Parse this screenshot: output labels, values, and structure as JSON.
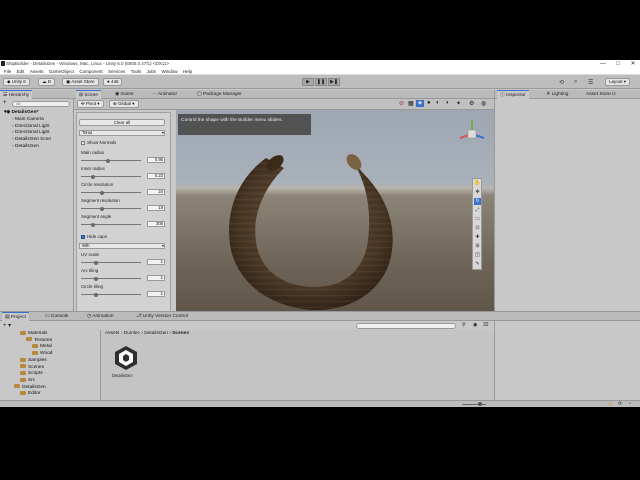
{
  "window": {
    "title": "ShipBuilder - DetailsGen - Windows, Mac, Linux - Unity 6.0 (6000.0.47f1) <DX11>",
    "controls": [
      "—",
      "□",
      "✕"
    ]
  },
  "menu": [
    "File",
    "Edit",
    "Assets",
    "GameObject",
    "Component",
    "Services",
    "Tools",
    "Jobs",
    "Window",
    "Help"
  ],
  "toolbar": {
    "account_label": "Unity 6",
    "cloud_label": "D",
    "asset_store_label": "Asset Store",
    "points_label": "446",
    "layout_label": "Layout"
  },
  "hierarchy": {
    "tab_label": "Hierarchy",
    "search_placeholder": "All",
    "items": [
      {
        "label": "DetailsGen*",
        "depth": 0
      },
      {
        "label": "Main Camera",
        "depth": 1
      },
      {
        "label": "Directional Light",
        "depth": 1
      },
      {
        "label": "Directional Light",
        "depth": 1
      },
      {
        "label": "DetailsGen Scen",
        "depth": 1
      },
      {
        "label": "DetailsGen",
        "depth": 1
      }
    ]
  },
  "scene_tabs": {
    "scene": "Scene",
    "game": "Game",
    "animator": "Animator",
    "package_manager": "Package Manager",
    "pivot": "Pivot",
    "global": "Global"
  },
  "builder": {
    "clear_all": "Clear all",
    "shape_type": "Torus",
    "show_normals": "Show Normals",
    "fields": [
      {
        "label": "Main radius",
        "value": "0.95",
        "fill": 0.45
      },
      {
        "label": "Inner radius",
        "value": "0.23",
        "fill": 0.2
      },
      {
        "label": "Circle resolution",
        "value": "24",
        "fill": 0.35
      },
      {
        "label": "Segment resolution",
        "value": "19",
        "fill": 0.35
      },
      {
        "label": "Segment angle",
        "value": "308",
        "fill": 0.2
      }
    ],
    "hide_caps": "Hide caps",
    "uv_mode": "Wth",
    "fields2": [
      {
        "label": "UV scale",
        "value": "1",
        "fill": 0.25
      },
      {
        "label": "Arc tiling",
        "value": "1",
        "fill": 0.25
      },
      {
        "label": "Circle tiling",
        "value": "1",
        "fill": 0.25
      }
    ]
  },
  "scene": {
    "tooltip": "Control the shape with the Builder menu sliders.",
    "persp_label": "Persp"
  },
  "inspector": {
    "tab_label": "Inspector",
    "lighting_label": "Lighting",
    "asset_store_tab": "Asset Store U"
  },
  "bottom": {
    "project_tab": "Project",
    "console_tab": "Console",
    "animation_tab": "Animation",
    "version_control_tab": "Unity Version Control",
    "breadcrumb": [
      "Assets",
      "Dumlec",
      "DetailsGen",
      "Scenes"
    ],
    "count": "32",
    "folders": [
      {
        "label": "Materials",
        "depth": 1
      },
      {
        "label": "Textures",
        "depth": 2
      },
      {
        "label": "Metal",
        "depth": 3
      },
      {
        "label": "Wood",
        "depth": 3
      },
      {
        "label": "Samples",
        "depth": 1
      },
      {
        "label": "Scenes",
        "depth": 1
      },
      {
        "label": "Scripts",
        "depth": 1
      },
      {
        "label": "Src",
        "depth": 1
      },
      {
        "label": "DetailsGen",
        "depth": 0
      },
      {
        "label": "Editor",
        "depth": 1
      }
    ],
    "asset_name": "DetailsGen"
  },
  "colors": {
    "accent": "#3a72c9",
    "torus_dark": "#3a2a1a",
    "torus_light": "#6b543a"
  }
}
